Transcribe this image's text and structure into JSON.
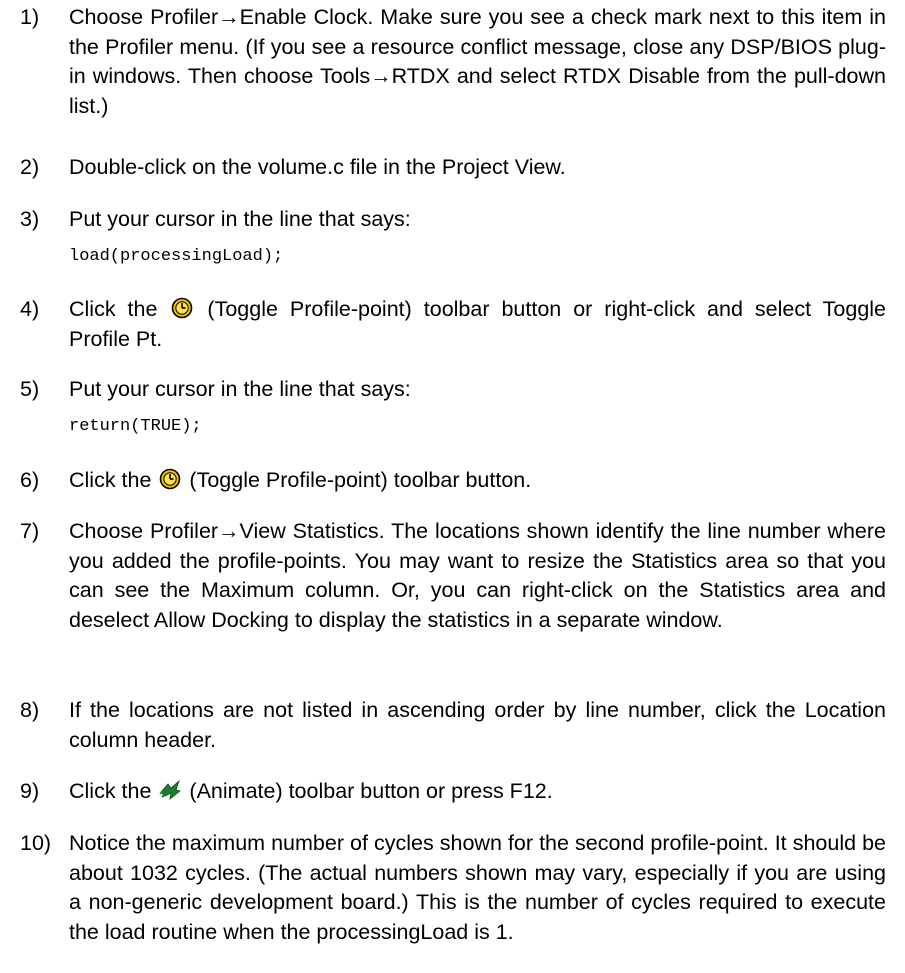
{
  "steps": [
    {
      "num": "1)",
      "text": "Choose Profiler→Enable Clock. Make sure you see a check mark next to this item in the Profiler menu. (If you see a resource conflict message, close any DSP/BIOS plug-in windows. Then choose Tools→RTDX and select RTDX Disable from the pull-down list.)"
    },
    {
      "num": "2)",
      "text": "Double-click on the volume.c file in the Project View."
    },
    {
      "num": "3)",
      "text": "Put your cursor in the line that says:",
      "code": "load(processingLoad);"
    },
    {
      "num": "4)",
      "before": "Click the",
      "icon": "profile-point-icon",
      "after": "(Toggle Profile-point) toolbar button or right-click and select Toggle Profile Pt."
    },
    {
      "num": "5)",
      "text": "Put your cursor in the line that says:",
      "code": "return(TRUE);"
    },
    {
      "num": "6)",
      "before": "Click the",
      "icon": "profile-point-icon",
      "after": "(Toggle Profile-point) toolbar button."
    },
    {
      "num": "7)",
      "text": "Choose Profiler→View Statistics. The locations shown identify the line number where you added the profile-points. You may want to resize the Statistics area so that you can see the Maximum column. Or, you can right-click on the Statistics area and deselect Allow Docking to display the statistics in a separate window."
    },
    {
      "num": "8)",
      "text": "If the locations are not listed in ascending order by line number, click the Location column header."
    },
    {
      "num": "9)",
      "before": "Click the",
      "icon": "animate-icon",
      "after": "(Animate) toolbar button or press F12."
    },
    {
      "num": "10)",
      "text": "Notice the maximum number of cycles shown for the second profile-point. It should be about 1032 cycles. (The actual numbers shown may vary, especially if you are using a non-generic development board.) This is the number of cycles required to execute the load routine when the processingLoad is 1."
    }
  ],
  "colors": {
    "text": "#000000",
    "profile_icon_fill": "#f2c200",
    "animate_icon": "#1a7f2e"
  }
}
